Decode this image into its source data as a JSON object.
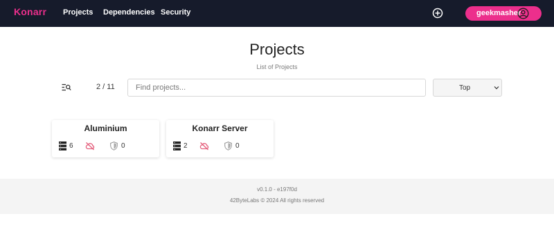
{
  "nav": {
    "brand": "Konarr",
    "links": [
      "Projects",
      "Dependencies",
      "Security"
    ],
    "user": "geekmasher"
  },
  "header": {
    "title": "Projects",
    "subtitle": "List of Projects"
  },
  "toolbar": {
    "count": "2 / 11",
    "search_placeholder": "Find projects...",
    "sort_selected": "Top"
  },
  "projects": [
    {
      "name": "Aluminium",
      "dependencies": "6",
      "alerts": "0"
    },
    {
      "name": "Konarr Server",
      "dependencies": "2",
      "alerts": "0"
    }
  ],
  "footer": {
    "version": "v0.1.0 - e197f0d",
    "copyright": "42ByteLabs © 2024 All rights reserved"
  },
  "colors": {
    "navbar": "#161b2b",
    "accent": "#ec2f8c",
    "footer": "#f4f4f4"
  }
}
